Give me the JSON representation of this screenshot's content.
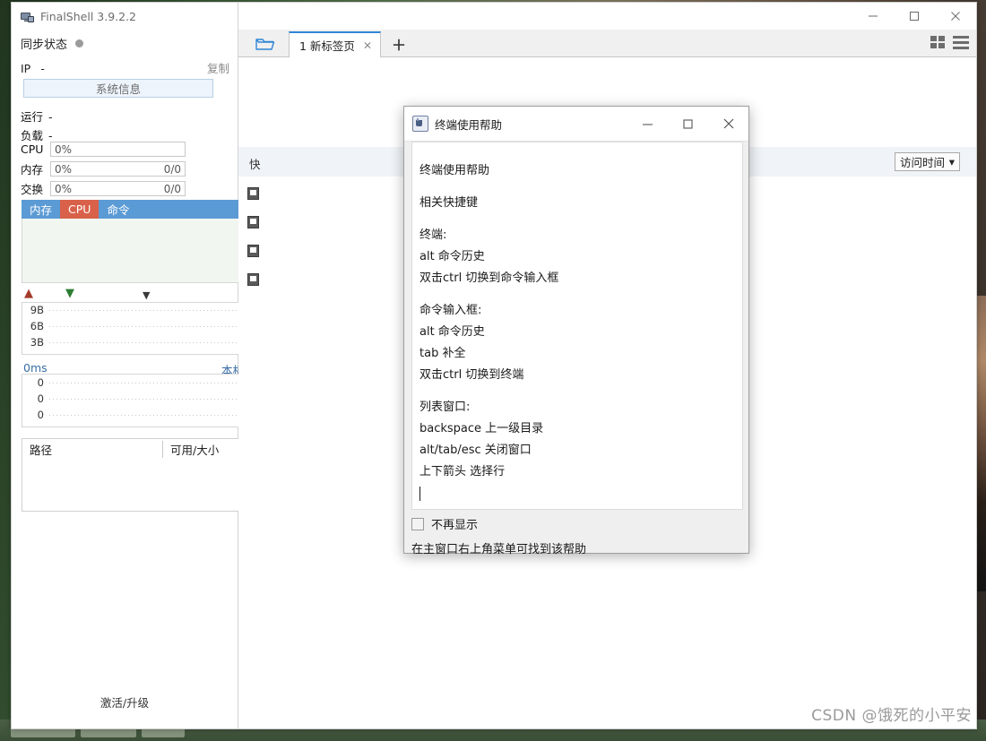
{
  "window": {
    "app_title": "FinalShell 3.9.2.2",
    "app_icon": "monitor-icon",
    "minimize": "—",
    "maximize": "□",
    "close": "✕"
  },
  "sidebar": {
    "sync": {
      "label": "同步状态",
      "status_icon": "status-dot"
    },
    "ip": {
      "label": "IP",
      "value": "-",
      "copy_label": "复制"
    },
    "sysinfo_button": "系统信息",
    "stats": [
      {
        "label": "运行",
        "value": "-"
      },
      {
        "label": "负载",
        "value": "-"
      }
    ],
    "meters": [
      {
        "label": "CPU",
        "percent": "0%",
        "fraction": ""
      },
      {
        "label": "内存",
        "percent": "0%",
        "fraction": "0/0"
      },
      {
        "label": "交换",
        "percent": "0%",
        "fraction": "0/0"
      }
    ],
    "proc_tabs": [
      {
        "label": "内存",
        "active": false
      },
      {
        "label": "CPU",
        "active": true
      },
      {
        "label": "命令",
        "active": false
      }
    ],
    "network": {
      "upload_icon": "arrow-up-icon",
      "download_icon": "arrow-down-icon",
      "more_icon": "chevron-down-icon",
      "y_ticks": [
        "9B",
        "6B",
        "3B"
      ]
    },
    "ping": {
      "latency": "0ms",
      "host": "本机",
      "y_ticks": [
        "0",
        "0",
        "0"
      ]
    },
    "disk": {
      "col_path": "路径",
      "col_size": "可用/大小"
    },
    "activate_link": "激活/升级"
  },
  "tabbar": {
    "folder_icon": "open-folder-icon",
    "tabs": [
      {
        "label": "1 新标签页",
        "close_icon": "✕"
      }
    ],
    "add_label": "＋",
    "grid_view_icon": "grid-view-icon",
    "list_view_icon": "list-view-icon"
  },
  "content": {
    "filter_label": "快",
    "visit_select": {
      "value": "访问时间",
      "caret": "▾"
    }
  },
  "dialog": {
    "title": "终端使用帮助",
    "icon": "java-icon",
    "minimize": "—",
    "maximize": "□",
    "close": "✕",
    "body_lines": [
      "终端使用帮助",
      "",
      "相关快捷键",
      "",
      "终端:",
      "alt 命令历史",
      "双击ctrl 切换到命令输入框",
      "",
      "命令输入框:",
      "alt 命令历史",
      "tab 补全",
      "双击ctrl 切换到终端",
      "",
      "列表窗口:",
      "backspace 上一级目录",
      "alt/tab/esc 关闭窗口",
      "上下箭头 选择行"
    ],
    "checkbox_label": "不再显示",
    "footer_note": "在主窗口右上角菜单可找到该帮助"
  },
  "watermark": "CSDN @饿死的小平安",
  "colors": {
    "tab_accent": "#2f86d6",
    "proc_tab_bg": "#5b9bd5",
    "proc_tab_active": "#d9614a",
    "upload_arrow": "#a33a2a",
    "download_arrow": "#2f7d32",
    "ping_text": "#3a6ea5"
  }
}
